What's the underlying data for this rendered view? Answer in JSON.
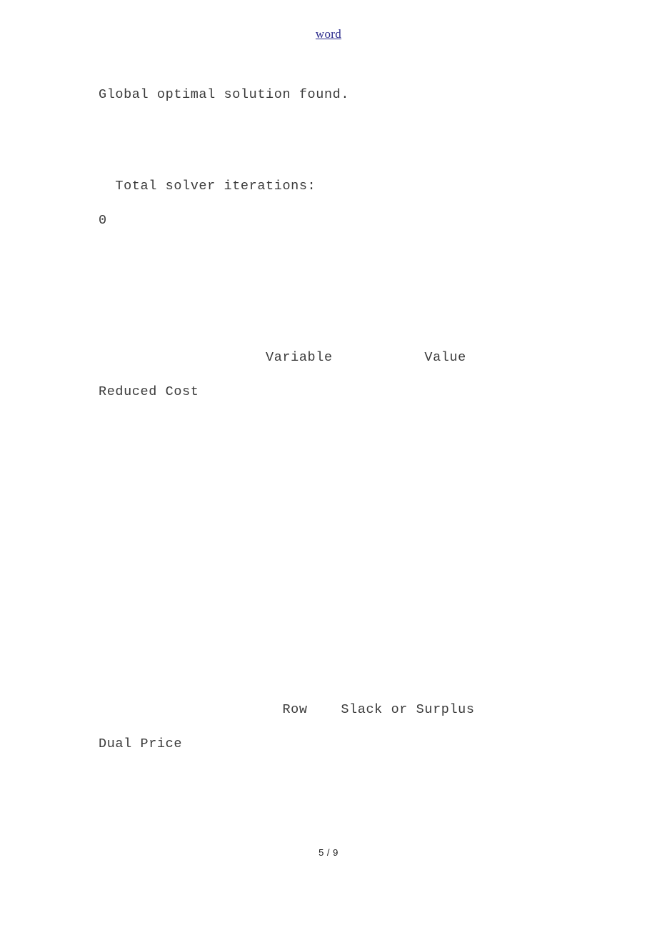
{
  "document": {
    "header": {
      "link_label": "word",
      "link_color": "#2a2a8c"
    },
    "body_lines": {
      "status": "Global optimal solution found.",
      "iterations_label": "  Total solver iterations:",
      "iterations_value": "0",
      "variable_header": "                    Variable           Value",
      "variable_header_wrap": "Reduced Cost",
      "row_header": "                      Row    Slack or Surplus",
      "row_header_wrap": "Dual Price"
    },
    "footer": {
      "page_indicator": "5 / 9",
      "current_page": "5",
      "total_pages": "9"
    }
  }
}
